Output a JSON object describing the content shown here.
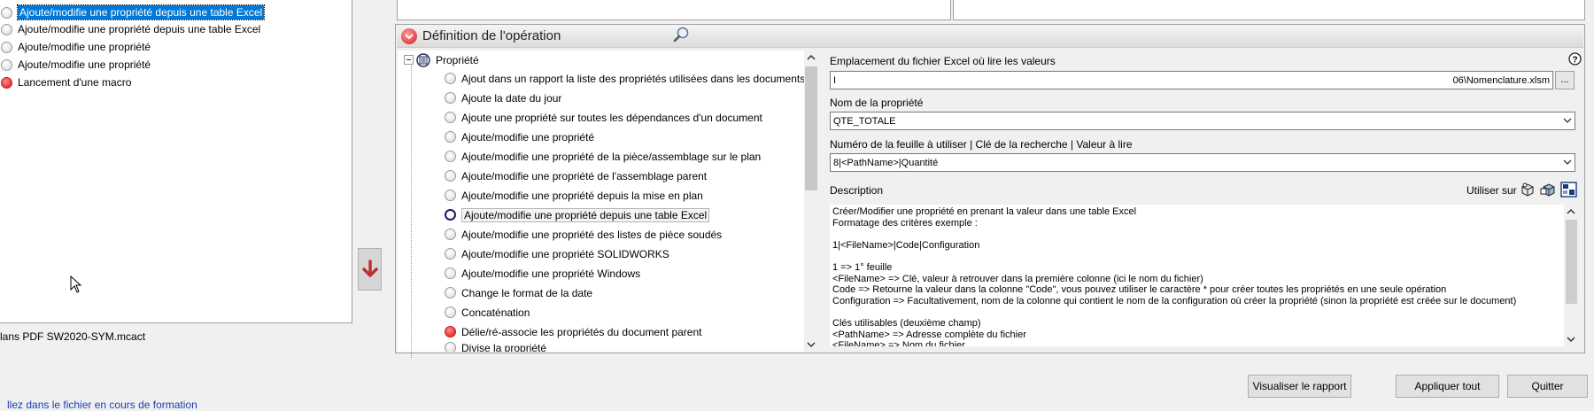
{
  "left_list": {
    "items": [
      {
        "label": "Ajoute/modifie une propriété depuis une table Excel",
        "state": "selected",
        "dot": "gray"
      },
      {
        "label": "Ajoute/modifie une propriété depuis une table Excel",
        "state": "normal",
        "dot": "gray"
      },
      {
        "label": "Ajoute/modifie une propriété",
        "state": "normal",
        "dot": "gray"
      },
      {
        "label": "Ajoute/modifie une propriété",
        "state": "normal",
        "dot": "gray"
      },
      {
        "label": "Lancement d'une macro",
        "state": "normal",
        "dot": "red"
      }
    ],
    "file_label": "lans PDF SW2020-SYM.mcact",
    "move_down_icon": "arrow-down-icon"
  },
  "definition": {
    "title": "Définition de l'opération",
    "tree": {
      "root": "Propriété",
      "items": [
        {
          "label": "Ajout dans un rapport la liste des propriétés utilisées dans les documents",
          "dot": "gray"
        },
        {
          "label": "Ajoute la date du jour",
          "dot": "gray"
        },
        {
          "label": "Ajoute une propriété sur toutes les dépendances d'un document",
          "dot": "gray"
        },
        {
          "label": "Ajoute/modifie une propriété",
          "dot": "gray"
        },
        {
          "label": "Ajoute/modifie une propriété de la pièce/assemblage sur le plan",
          "dot": "gray"
        },
        {
          "label": "Ajoute/modifie une propriété de l'assemblage parent",
          "dot": "gray"
        },
        {
          "label": "Ajoute/modifie une propriété depuis la mise en plan",
          "dot": "gray"
        },
        {
          "label": "Ajoute/modifie une propriété depuis une table Excel",
          "dot": "selected"
        },
        {
          "label": "Ajoute/modifie une propriété des listes de pièce soudés",
          "dot": "gray"
        },
        {
          "label": "Ajoute/modifie une propriété SOLIDWORKS",
          "dot": "gray"
        },
        {
          "label": "Ajoute/modifie une propriété Windows",
          "dot": "gray"
        },
        {
          "label": "Change le format de la date",
          "dot": "gray"
        },
        {
          "label": "Concaténation",
          "dot": "gray"
        },
        {
          "label": "Délie/ré-associe les propriétés du document parent",
          "dot": "red"
        },
        {
          "label": "Divise la propriété",
          "dot": "gray"
        }
      ]
    },
    "form": {
      "excel_path_label": "Emplacement du fichier Excel où lire les valeurs",
      "excel_path_value_left": "I",
      "excel_path_value_right": "06\\Nomenclature.xlsm",
      "browse_label": "...",
      "property_name_label": "Nom de la propriété",
      "property_name_value": "QTE_TOTALE",
      "sheet_label": "Numéro de la feuille à utiliser | Clé de la recherche | Valeur à lire",
      "sheet_value": "8|<PathName>|Quantité",
      "description_label": "Description",
      "use_on_label": "Utiliser sur",
      "description_text": "Créer/Modifier une propriété en prenant la valeur dans une table Excel\nFormatage des critères exemple :\n\n1|<FileName>|Code|Configuration\n\n1 => 1° feuille\n<FileName> => Clé, valeur à retrouver dans la première colonne (ici le nom du fichier)\nCode => Retourne la valeur dans la colonne \"Code\", vous pouvez utiliser le caractère * pour créer toutes les propriétés en une seule opération\nConfiguration => Facultativement, nom de la colonne qui contient le nom de la configuration où créer la propriété (sinon la propriété est créée sur le document)\n\nClés utilisables (deuxième champ)\n<PathName> => Adresse complète du fichier\n<FileName> => Nom du fichier"
    }
  },
  "buttons": {
    "report": "Visualiser le rapport",
    "apply_all": "Appliquer tout",
    "quit": "Quitter"
  },
  "bottom_link": "llez dans le fichier en cours de formation"
}
